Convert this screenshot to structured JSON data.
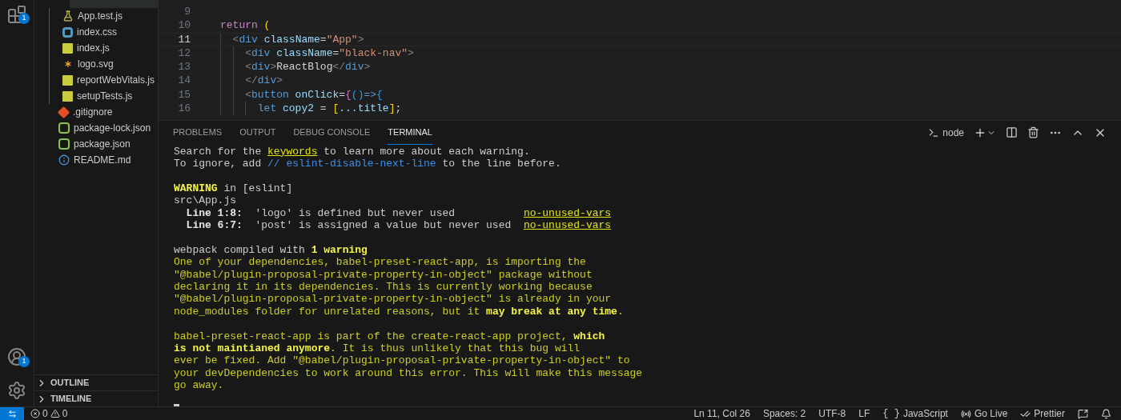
{
  "activity_bar": {
    "extensions_badge": "1",
    "accounts_badge": "1"
  },
  "explorer": {
    "src_files": [
      {
        "name": "App.test.js",
        "kind": "test"
      },
      {
        "name": "index.css",
        "kind": "css"
      },
      {
        "name": "index.js",
        "kind": "js"
      },
      {
        "name": "logo.svg",
        "kind": "svg"
      },
      {
        "name": "reportWebVitals.js",
        "kind": "js"
      },
      {
        "name": "setupTests.js",
        "kind": "js"
      }
    ],
    "root_files": [
      {
        "name": ".gitignore",
        "kind": "git"
      },
      {
        "name": "package-lock.json",
        "kind": "node"
      },
      {
        "name": "package.json",
        "kind": "node"
      },
      {
        "name": "README.md",
        "kind": "info"
      }
    ],
    "sections": [
      {
        "label": "OUTLINE",
        "expanded": false
      },
      {
        "label": "TIMELINE",
        "expanded": false
      }
    ]
  },
  "editor": {
    "lines": [
      {
        "number": "9",
        "current": false
      },
      {
        "number": "10",
        "current": false,
        "tokens": [
          {
            "text": "return ",
            "kind": "keyword"
          },
          {
            "text": "(",
            "kind": "bracket"
          }
        ],
        "children": [
          {
            "number": "11",
            "current": true,
            "tokens": [
              {
                "text": "<",
                "kind": "punct"
              },
              {
                "text": "div ",
                "kind": "tag"
              },
              {
                "text": "className",
                "kind": "attr"
              },
              {
                "text": "=",
                "kind": "plain"
              },
              {
                "text": "\"App\"",
                "kind": "string"
              },
              {
                "text": ">",
                "kind": "punct"
              }
            ],
            "children": [
              {
                "number": "12",
                "current": false,
                "tokens": [
                  {
                    "text": "<",
                    "kind": "punct"
                  },
                  {
                    "text": "div ",
                    "kind": "tag"
                  },
                  {
                    "text": "className",
                    "kind": "attr"
                  },
                  {
                    "text": "=",
                    "kind": "plain"
                  },
                  {
                    "text": "\"black-nav\"",
                    "kind": "string"
                  },
                  {
                    "text": ">",
                    "kind": "punct"
                  }
                ]
              },
              {
                "number": "13",
                "current": false,
                "tokens": [
                  {
                    "text": "<",
                    "kind": "punct"
                  },
                  {
                    "text": "div",
                    "kind": "tag"
                  },
                  {
                    "text": ">",
                    "kind": "punct"
                  },
                  {
                    "text": "ReactBlog",
                    "kind": "plain"
                  },
                  {
                    "text": "</",
                    "kind": "punct"
                  },
                  {
                    "text": "div",
                    "kind": "tag"
                  },
                  {
                    "text": ">",
                    "kind": "punct"
                  }
                ]
              },
              {
                "number": "14",
                "current": false,
                "tokens": [
                  {
                    "text": "</",
                    "kind": "punct"
                  },
                  {
                    "text": "div",
                    "kind": "tag"
                  },
                  {
                    "text": ">",
                    "kind": "punct"
                  }
                ]
              },
              {
                "number": "15",
                "current": false,
                "tokens": [
                  {
                    "text": "<",
                    "kind": "punct"
                  },
                  {
                    "text": "button ",
                    "kind": "tag"
                  },
                  {
                    "text": "onClick",
                    "kind": "attr"
                  },
                  {
                    "text": "=",
                    "kind": "plain"
                  },
                  {
                    "text": "{",
                    "kind": "brace"
                  },
                  {
                    "text": "()",
                    "kind": "bracket2"
                  },
                  {
                    "text": "=>",
                    "kind": "tag"
                  },
                  {
                    "text": "{",
                    "kind": "bracket2"
                  }
                ],
                "children": [
                  {
                    "number": "16",
                    "current": false,
                    "tokens": [
                      {
                        "text": "let ",
                        "kind": "tag"
                      },
                      {
                        "text": "copy2",
                        "kind": "attr"
                      },
                      {
                        "text": " = ",
                        "kind": "plain"
                      },
                      {
                        "text": "[",
                        "kind": "bracket"
                      },
                      {
                        "text": "...title",
                        "kind": "attr"
                      },
                      {
                        "text": "]",
                        "kind": "bracket"
                      },
                      {
                        "text": ";",
                        "kind": "plain"
                      }
                    ]
                  }
                ]
              }
            ]
          }
        ]
      }
    ]
  },
  "panel": {
    "tabs": [
      {
        "label": "PROBLEMS",
        "selected": false
      },
      {
        "label": "OUTPUT",
        "selected": false
      },
      {
        "label": "DEBUG CONSOLE",
        "selected": false
      },
      {
        "label": "TERMINAL",
        "selected": true
      }
    ],
    "terminal_name": "node",
    "blocks": [
      [
        {
          "kind": "plain",
          "segments": [
            {
              "text": "Search for the ",
              "kind": "plain"
            },
            {
              "text": "keywords",
              "kind": "link"
            },
            {
              "text": " to learn more about each warning.",
              "kind": "plain"
            }
          ]
        },
        {
          "kind": "plain",
          "segments": [
            {
              "text": "To ignore, add ",
              "kind": "plain"
            },
            {
              "text": "// eslint-disable-next-line",
              "kind": "comment"
            },
            {
              "text": " to the line before.",
              "kind": "plain"
            }
          ]
        }
      ],
      [
        {
          "kind": "plain",
          "segments": [
            {
              "text": "WARNING",
              "kind": "warn"
            },
            {
              "text": " in [eslint]",
              "kind": "plain"
            }
          ]
        },
        {
          "kind": "plain",
          "segments": [
            {
              "text": "src\\App.js",
              "kind": "plain"
            }
          ]
        },
        {
          "kind": "indented",
          "segments": [
            {
              "text": "Line 1:8:",
              "kind": "bold"
            },
            {
              "text": "  'logo' is defined but never used           ",
              "kind": "plain"
            },
            {
              "text": "no-unused-vars",
              "kind": "link"
            }
          ]
        },
        {
          "kind": "indented",
          "segments": [
            {
              "text": "Line 6:7:",
              "kind": "bold"
            },
            {
              "text": "  'post' is assigned a value but never used  ",
              "kind": "plain"
            },
            {
              "text": "no-unused-vars",
              "kind": "link"
            }
          ]
        }
      ],
      [
        {
          "kind": "plain",
          "segments": [
            {
              "text": "webpack compiled with ",
              "kind": "plain"
            },
            {
              "text": "1 warning",
              "kind": "warn"
            }
          ]
        },
        {
          "kind": "plain",
          "segments": [
            {
              "text": "One of your dependencies, babel-preset-react-app, is importing the",
              "kind": "yellow"
            }
          ]
        },
        {
          "kind": "plain",
          "segments": [
            {
              "text": "\"@babel/plugin-proposal-private-property-in-object\" package without",
              "kind": "yellow"
            }
          ]
        },
        {
          "kind": "plain",
          "segments": [
            {
              "text": "declaring it in its dependencies. This is currently working because",
              "kind": "yellow"
            }
          ]
        },
        {
          "kind": "plain",
          "segments": [
            {
              "text": "\"@babel/plugin-proposal-private-property-in-object\" is already in your",
              "kind": "yellow"
            }
          ]
        },
        {
          "kind": "plain",
          "segments": [
            {
              "text": "node_modules folder for unrelated reasons, but it ",
              "kind": "yellow"
            },
            {
              "text": "may break at any time",
              "kind": "warn"
            },
            {
              "text": ".",
              "kind": "yellow"
            }
          ]
        }
      ],
      [
        {
          "kind": "plain",
          "segments": [
            {
              "text": "babel-preset-react-app is part of the create-react-app project, ",
              "kind": "yellow"
            },
            {
              "text": "which",
              "kind": "warn"
            }
          ]
        },
        {
          "kind": "plain",
          "segments": [
            {
              "text": "is not maintianed anymore",
              "kind": "warn"
            },
            {
              "text": ". It is thus unlikely that this bug will",
              "kind": "yellow"
            }
          ]
        },
        {
          "kind": "plain",
          "segments": [
            {
              "text": "ever be fixed. Add \"@babel/plugin-proposal-private-property-in-object\" to",
              "kind": "yellow"
            }
          ]
        },
        {
          "kind": "plain",
          "segments": [
            {
              "text": "your devDependencies to work around this error. This will make this message",
              "kind": "yellow"
            }
          ]
        },
        {
          "kind": "plain",
          "segments": [
            {
              "text": "go away.",
              "kind": "yellow"
            }
          ]
        }
      ]
    ]
  },
  "status_bar": {
    "errors": "0",
    "warnings": "0",
    "items": [
      {
        "text": "Ln 11, Col 26",
        "kind": "text"
      },
      {
        "text": "Spaces: 2",
        "kind": "text"
      },
      {
        "text": "UTF-8",
        "kind": "text"
      },
      {
        "text": "LF",
        "kind": "text"
      },
      {
        "text": "JavaScript",
        "kind": "glyph",
        "glyph": "{ }"
      },
      {
        "text": "Go Live",
        "kind": "broadcast"
      },
      {
        "text": "Prettier",
        "kind": "check"
      }
    ]
  }
}
